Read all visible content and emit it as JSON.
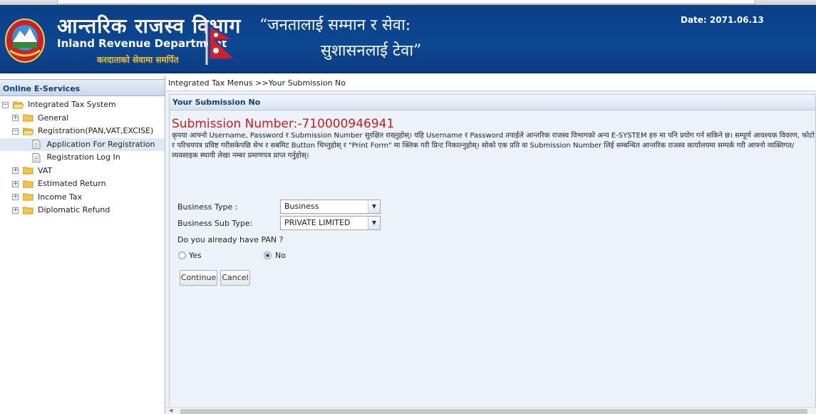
{
  "header": {
    "title_np": "आन्तरिक राजस्व विभाग",
    "title_en": "Inland Revenue Department",
    "tagline": "करदाताको सेवामा समर्पित",
    "slogan_line1": "“जनतालाई सम्मान र सेवा:",
    "slogan_line2": "सुशासनलाई टेवा”",
    "date": "Date:  2071.06.13"
  },
  "sidebar": {
    "title": "Online E-Services",
    "tree": {
      "root": "Integrated Tax System",
      "general": "General",
      "registration": "Registration(PAN,VAT,EXCISE)",
      "application": "Application For Registration",
      "reg_login": "Registration Log In",
      "vat": "VAT",
      "estimated": "Estimated Return",
      "income": "Income Tax",
      "diplomatic": "Diplomatic Refund"
    }
  },
  "main": {
    "breadcrumb": "Integrated Tax Menus >>Your Submission No",
    "panel_title": "Your Submission No",
    "submission_number": "Submission Number:-710000946941",
    "notice": "कृपया आफ्नो Username, Password र Submission Number सुरक्षित राख्नुहोस्। यहि Username र Password तपाईले आन्तरिक राजस्व विभागको अन्य E-SYSTEM हरु मा पनि प्रयोग गर्न सकिने छ। सम्पूर्ण आवश्यक विवरण, फोटो र परिचयपत्र प्रविष्ट गरीसकेपछि सेभ र सबमिट Button थिच्नुहोस् र \"Print Form\" मा क्लिक गरी प्रिन्ट निकाल्नुहोस्। सोको एक प्रति वा Submission Number लिई सम्बन्धित आन्तरिक राजस्व कार्यालयमा सम्पर्क गरी आफ्नो व्यक्तिगत/व्यवसाइक स्थायी लेखा नम्बर प्रमाणपत्र प्राप्त गर्नुहोस्।",
    "form": {
      "business_type_label": "Business Type :",
      "business_type_value": "Business",
      "business_subtype_label": "Business Sub Type:",
      "business_subtype_value": "PRIVATE LIMITED",
      "pan_question": "Do you already have PAN ?",
      "yes_label": "Yes",
      "no_label": "No",
      "continue_label": "Continue",
      "cancel_label": "Cancel"
    }
  },
  "colors": {
    "header_bg": "#0d4792",
    "submission_red": "#d11a1a",
    "sidebar_title": "#0f3d7a"
  }
}
